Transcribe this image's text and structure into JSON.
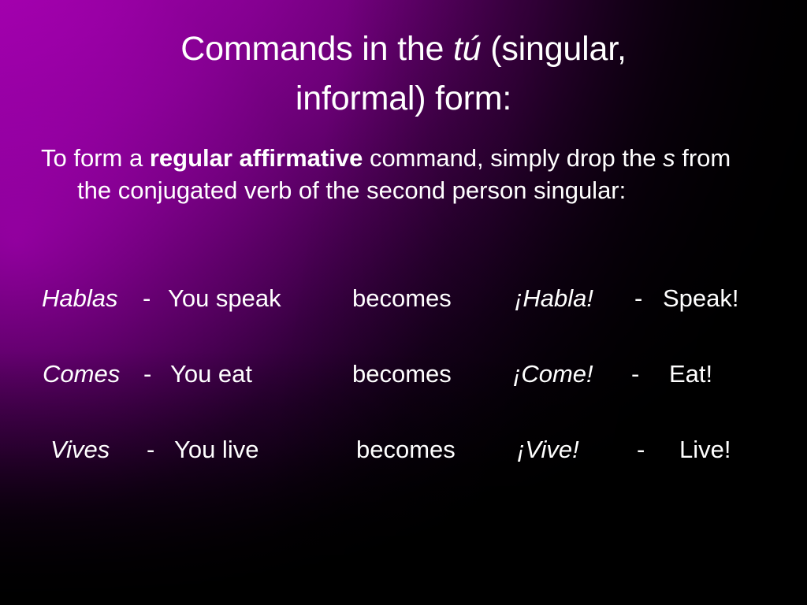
{
  "slide": {
    "title_line1_pre": "Commands in the ",
    "title_line1_italic": "tú",
    "title_line1_post": " (singular,",
    "title_line2": "informal) form:",
    "body": {
      "pre_bold": "To form a ",
      "bold": "regular affirmative",
      "mid": " command, simply drop the ",
      "italic": "s",
      "post": " from the conjugated verb of the second person singular:"
    },
    "examples": [
      {
        "spanish": "Hablas",
        "dash1": "-",
        "english": "You speak",
        "becomes": "becomes",
        "command": "¡Habla!",
        "dash2": "-",
        "result": "Speak!"
      },
      {
        "spanish": "Comes",
        "dash1": "-",
        "english": "You eat",
        "becomes": "becomes",
        "command": "¡Come!",
        "dash2": "-",
        "result": "Eat!"
      },
      {
        "spanish": "Vives",
        "dash1": "-",
        "english": "You live",
        "becomes": "becomes",
        "command": "¡Vive!",
        "dash2": "-",
        "result": "Live!"
      }
    ],
    "colors": {
      "accent_magenta": "#b400bd",
      "background_black": "#000000",
      "text_white": "#ffffff"
    }
  }
}
